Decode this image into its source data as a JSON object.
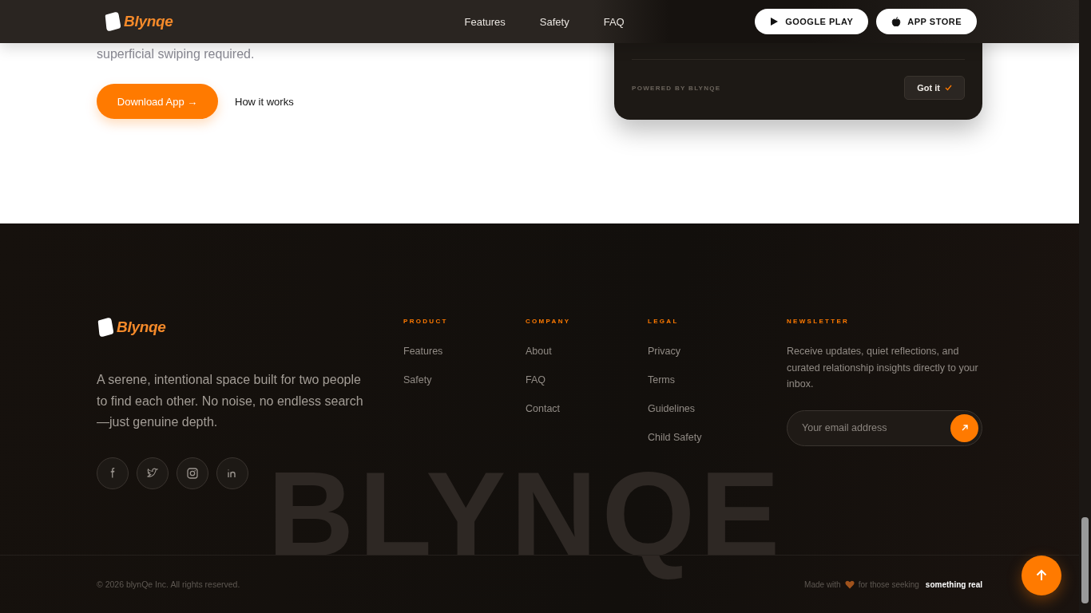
{
  "header": {
    "logo": "Blynqe",
    "nav": [
      {
        "label": "Features"
      },
      {
        "label": "Safety"
      },
      {
        "label": "FAQ"
      }
    ],
    "store_buttons": [
      {
        "label": "GOOGLE PLAY",
        "kind": "play"
      },
      {
        "label": "APP STORE",
        "kind": "apple"
      }
    ]
  },
  "hero": {
    "text": "superficial swiping required.",
    "primary_button": "Download App →",
    "secondary_link": "How it works"
  },
  "notice_card": {
    "powered_by": "POWERED BY BLYNQE",
    "button": "Got it"
  },
  "footer": {
    "logo": "Blynqe",
    "description": "A serene, intentional space built for two people to find each other. No noise, no endless search —just genuine depth.",
    "socials": [
      {
        "kind": "facebook"
      },
      {
        "kind": "twitter"
      },
      {
        "kind": "instagram"
      },
      {
        "kind": "linkedin"
      }
    ],
    "columns": [
      {
        "heading": "PRODUCT",
        "links": [
          "Features",
          "Safety"
        ]
      },
      {
        "heading": "COMPANY",
        "links": [
          "About",
          "FAQ",
          "Contact"
        ]
      },
      {
        "heading": "LEGAL",
        "links": [
          "Privacy",
          "Terms",
          "Guidelines",
          "Child Safety"
        ]
      }
    ],
    "newsletter": {
      "heading": "NEWSLETTER",
      "text": "Receive updates, quiet reflections, and curated relationship insights directly to your inbox.",
      "placeholder": "Your email address"
    },
    "wordmark": "BLYNQE",
    "copyright": "© 2026 blynQe Inc. All rights reserved.",
    "tagline": {
      "before": "Made with",
      "after": "for those seeking",
      "highlight": "something real"
    }
  }
}
